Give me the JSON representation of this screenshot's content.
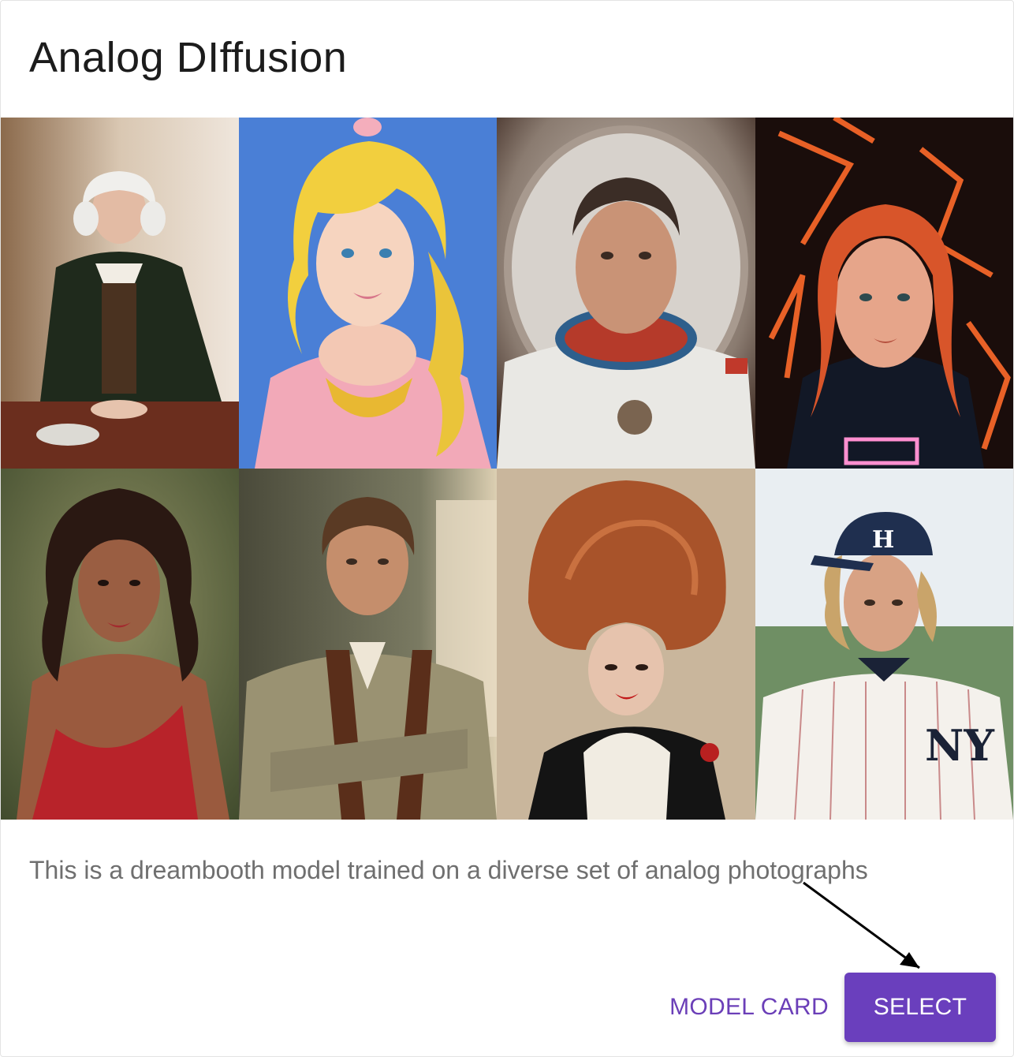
{
  "dialog": {
    "title": "Analog DIffusion",
    "description": "This is a dreambooth model trained on a diverse set of analog photographs",
    "actions": {
      "model_card_label": "MODEL CARD",
      "select_label": "SELECT"
    },
    "colors": {
      "accent": "#6a3fbd",
      "title_text": "#1c1c1c",
      "body_text": "#6f6f6f"
    }
  },
  "gallery": {
    "images": [
      {
        "subject": "portrait-colonial-gentleman"
      },
      {
        "subject": "portrait-blonde-woman-pink-dress"
      },
      {
        "subject": "portrait-astronaut"
      },
      {
        "subject": "portrait-woman-neon-lights"
      },
      {
        "subject": "portrait-woman-red-dress"
      },
      {
        "subject": "portrait-man-holster"
      },
      {
        "subject": "portrait-woman-beehive-hair"
      },
      {
        "subject": "portrait-baseball-player"
      }
    ]
  }
}
